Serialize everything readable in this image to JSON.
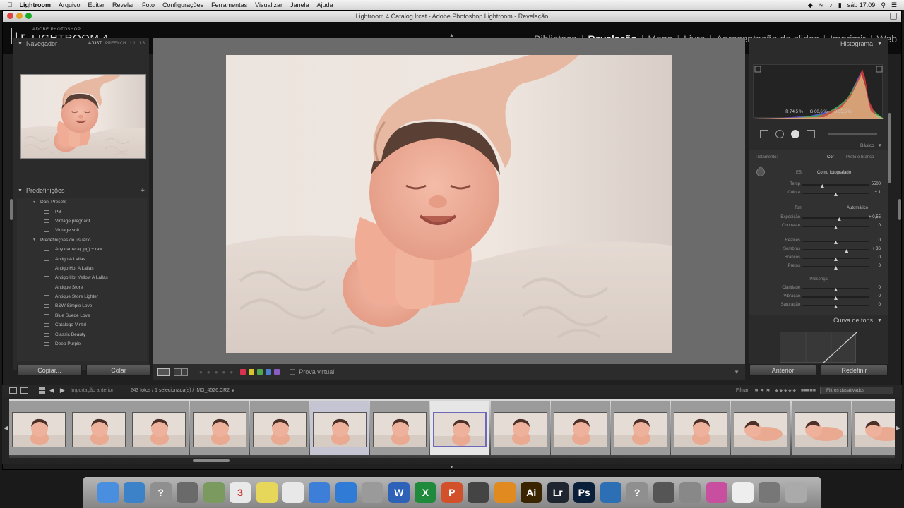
{
  "menubar": {
    "app": "Lightroom",
    "items": [
      "Arquivo",
      "Editar",
      "Revelar",
      "Foto",
      "Configurações",
      "Ferramentas",
      "Visualizar",
      "Janela",
      "Ajuda"
    ],
    "clock": "sáb 17:09"
  },
  "window": {
    "title": "Lightroom 4 Catalog.lrcat - Adobe Photoshop Lightroom - Revelação"
  },
  "identity": {
    "logo": "Lr",
    "vendor": "ADOBE PHOTOSHOP",
    "product": "LIGHTROOM 4"
  },
  "modules": [
    {
      "label": "Biblioteca",
      "active": false
    },
    {
      "label": "Revelação",
      "active": true
    },
    {
      "label": "Mapa",
      "active": false
    },
    {
      "label": "Livro",
      "active": false
    },
    {
      "label": "Apresentação de slides",
      "active": false
    },
    {
      "label": "Imprimir",
      "active": false
    },
    {
      "label": "Web",
      "active": false
    }
  ],
  "left": {
    "navigator": {
      "title": "Navegador",
      "zoom_options": [
        "AJUST",
        "PREENCH",
        "1:1",
        "1:3"
      ]
    },
    "presets": {
      "title": "Predefinições",
      "rows": [
        {
          "kind": "folder",
          "label": "Dani Presets"
        },
        {
          "kind": "item",
          "label": "PB"
        },
        {
          "kind": "item",
          "label": "Vintage pregnant"
        },
        {
          "kind": "item",
          "label": "Vintage soft"
        },
        {
          "kind": "folder",
          "label": "Predefinições do usuário"
        },
        {
          "kind": "item",
          "label": "Any camera(.jpg) + raw"
        },
        {
          "kind": "item",
          "label": "Antigo A Lallas"
        },
        {
          "kind": "item",
          "label": "Antigo Hot A Lallas"
        },
        {
          "kind": "item",
          "label": "Antigo Hot Yellow A Lallas"
        },
        {
          "kind": "item",
          "label": "Antique Store"
        },
        {
          "kind": "item",
          "label": "Antique Store Lighter"
        },
        {
          "kind": "item",
          "label": "B&W Simple Love"
        },
        {
          "kind": "item",
          "label": "Blue Suede Love"
        },
        {
          "kind": "item",
          "label": "Catalogo Vintirl"
        },
        {
          "kind": "item",
          "label": "Classic Beauty"
        },
        {
          "kind": "item",
          "label": "Deep Purple"
        }
      ]
    },
    "buttons": {
      "copy": "Copiar...",
      "paste": "Colar"
    }
  },
  "toolbar": {
    "soft_proof": "Prova virtual",
    "colors": [
      "#d9334d",
      "#d8c52c",
      "#4fa84f",
      "#4e7ed0",
      "#8a5cc4"
    ]
  },
  "right": {
    "histogram": {
      "title": "Histograma",
      "readout": [
        "R 74,5 %",
        "G 60,6 %",
        "B 55,5 %"
      ]
    },
    "basic": {
      "title": "Básico",
      "treatment_label": "Tratamento:",
      "treatment_options": [
        "Cor",
        "Preto e branco"
      ],
      "wb_label": "EB:",
      "wb_value": "Como fotografado",
      "tone_label": "Tom",
      "auto_label": "Automático",
      "presence_label": "Presença",
      "sliders": [
        {
          "label": "Temp",
          "value": "5500",
          "pos": 0.3
        },
        {
          "label": "Colora",
          "value": "+ 1",
          "pos": 0.5
        },
        {
          "label": "Exposição",
          "value": "+ 0,55",
          "pos": 0.55
        },
        {
          "label": "Contraste",
          "value": "0",
          "pos": 0.5
        },
        {
          "label": "Realces",
          "value": "0",
          "pos": 0.5
        },
        {
          "label": "Sombras",
          "value": "+ 36",
          "pos": 0.66
        },
        {
          "label": "Brancos",
          "value": "0",
          "pos": 0.5
        },
        {
          "label": "Pretos",
          "value": "0",
          "pos": 0.5
        },
        {
          "label": "Claridade",
          "value": "0",
          "pos": 0.5
        },
        {
          "label": "Vibração",
          "value": "0",
          "pos": 0.5
        },
        {
          "label": "Saturação",
          "value": "0",
          "pos": 0.5
        }
      ]
    },
    "tone_curve": {
      "title": "Curva de tons"
    },
    "buttons": {
      "previous": "Anterior",
      "reset": "Redefinir"
    }
  },
  "filmstrip": {
    "source": "Importação anterior",
    "count": "243 fotos / 1 selecionada(s) / IMG_4526.CR2",
    "filter_label": "Filtrar:",
    "filter_value": "Filtros desativados",
    "thumbs": [
      {
        "state": "normal",
        "pose": "head"
      },
      {
        "state": "normal",
        "pose": "head"
      },
      {
        "state": "normal",
        "pose": "head"
      },
      {
        "state": "normal",
        "pose": "head"
      },
      {
        "state": "normal",
        "pose": "head"
      },
      {
        "state": "selected",
        "pose": "head"
      },
      {
        "state": "normal",
        "pose": "head"
      },
      {
        "state": "current",
        "pose": "head"
      },
      {
        "state": "normal",
        "pose": "head"
      },
      {
        "state": "normal",
        "pose": "head"
      },
      {
        "state": "normal",
        "pose": "head"
      },
      {
        "state": "normal",
        "pose": "head"
      },
      {
        "state": "normal",
        "pose": "lying"
      },
      {
        "state": "normal",
        "pose": "lying"
      },
      {
        "state": "normal",
        "pose": "lying"
      }
    ]
  },
  "dock": {
    "apps": [
      {
        "name": "finder-icon",
        "label": "",
        "color": "#4a8ee0"
      },
      {
        "name": "safari-icon",
        "label": "",
        "color": "#3b82c8"
      },
      {
        "name": "help-icon",
        "label": "?",
        "color": "#8f8f8f"
      },
      {
        "name": "launchpad-icon",
        "label": "",
        "color": "#6a6a6a"
      },
      {
        "name": "preview-icon",
        "label": "",
        "color": "#7a9a60"
      },
      {
        "name": "calendar-icon",
        "label": "3",
        "color": "#e9e9e9"
      },
      {
        "name": "stickies-icon",
        "label": "",
        "color": "#e6d75a"
      },
      {
        "name": "textedit-icon",
        "label": "",
        "color": "#e8e8e8"
      },
      {
        "name": "itunes-icon",
        "label": "",
        "color": "#3d7fd8"
      },
      {
        "name": "appstore-icon",
        "label": "",
        "color": "#2f7bd6"
      },
      {
        "name": "system-preferences-icon",
        "label": "",
        "color": "#9a9a9a"
      },
      {
        "name": "word-icon",
        "label": "W",
        "color": "#2d62b8"
      },
      {
        "name": "excel-icon",
        "label": "X",
        "color": "#1f8a3b"
      },
      {
        "name": "powerpoint-icon",
        "label": "P",
        "color": "#d2502a"
      },
      {
        "name": "imovie-icon",
        "label": "",
        "color": "#444"
      },
      {
        "name": "ftp-icon",
        "label": "",
        "color": "#e08a20"
      },
      {
        "name": "illustrator-icon",
        "label": "Ai",
        "color": "#3a2400"
      },
      {
        "name": "lightroom-icon",
        "label": "Lr",
        "color": "#1f2630"
      },
      {
        "name": "photoshop-icon",
        "label": "Ps",
        "color": "#0a1f3a"
      },
      {
        "name": "quicktime-icon",
        "label": "",
        "color": "#2d6fb5"
      },
      {
        "name": "help-icon-2",
        "label": "?",
        "color": "#8f8f8f"
      },
      {
        "name": "printer-icon",
        "label": "",
        "color": "#555"
      },
      {
        "name": "scanner-icon",
        "label": "",
        "color": "#888"
      },
      {
        "name": "color-app-icon",
        "label": "",
        "color": "#c84fa0"
      },
      {
        "name": "document-icon",
        "label": "",
        "color": "#eee"
      },
      {
        "name": "screen-icon",
        "label": "",
        "color": "#777"
      },
      {
        "name": "trash-icon",
        "label": "",
        "color": "#aaa"
      }
    ]
  }
}
